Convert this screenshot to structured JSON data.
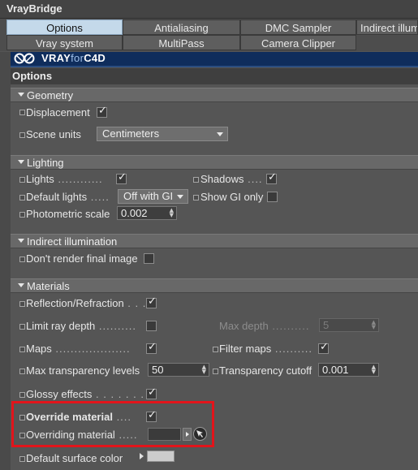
{
  "window": {
    "title": "VrayBridge"
  },
  "tabs": {
    "row1": [
      "Options",
      "Antialiasing",
      "DMC Sampler",
      "Indirect illum"
    ],
    "row2": [
      "Vray system",
      "MultiPass",
      "Camera Clipper"
    ]
  },
  "logo": {
    "part1": "VRAY",
    "part2": "for",
    "part3": "C4D"
  },
  "options_title": "Options",
  "geometry": {
    "header": "Geometry",
    "displacement_label": "Displacement",
    "scene_units_label": "Scene units",
    "scene_units_value": "Centimeters"
  },
  "lighting": {
    "header": "Lighting",
    "lights_label": "Lights",
    "shadows_label": "Shadows",
    "default_lights_label": "Default lights",
    "default_lights_value": "Off with GI",
    "show_gi_only_label": "Show GI only",
    "photometric_label": "Photometric scale",
    "photometric_value": "0.002"
  },
  "indirect": {
    "header": "Indirect illumination",
    "dont_render_label": "Don't render final image"
  },
  "materials": {
    "header": "Materials",
    "reflection_label": "Reflection/Refraction",
    "limit_depth_label": "Limit ray depth",
    "max_depth_label": "Max depth",
    "max_depth_value": "5",
    "maps_label": "Maps",
    "filter_maps_label": "Filter maps",
    "max_transp_label": "Max transparency levels",
    "max_transp_value": "50",
    "transp_cutoff_label": "Transparency cutoff",
    "transp_cutoff_value": "0.001",
    "glossy_label": "Glossy effects",
    "override_label": "Override material",
    "overriding_label": "Overriding material",
    "default_surface_label": "Default surface color"
  },
  "colors": {
    "highlight": "#e2141b",
    "active_tab": "#c4d9ea",
    "logo_bg": "#0f2d5c"
  }
}
